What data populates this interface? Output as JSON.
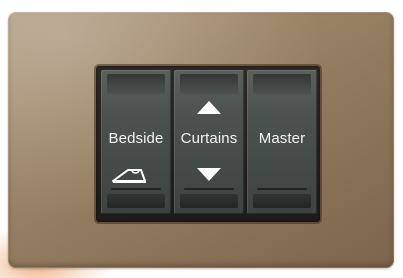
{
  "switches": [
    {
      "label": "Bedside",
      "icon": "bedside-lamp-icon"
    },
    {
      "label": "Curtains",
      "icon_up": "arrow-up-icon",
      "icon_down": "arrow-down-icon"
    },
    {
      "label": "Master"
    }
  ],
  "colors": {
    "plate": "#9b8366",
    "rocker": "#4c5250",
    "frame": "#1e1c1a",
    "label": "#f2f2f2"
  }
}
